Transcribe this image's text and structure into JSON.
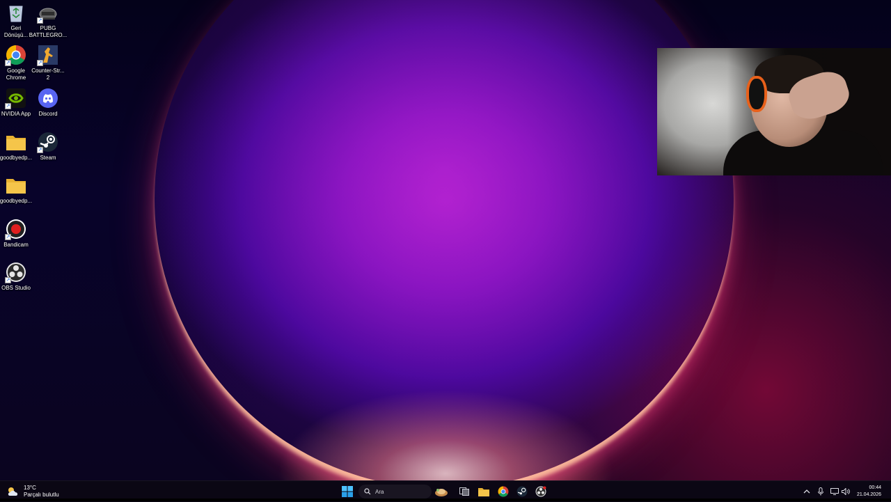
{
  "desktop": {
    "icons": [
      {
        "name": "recycle-bin",
        "label": "Geri\nDönüşü..."
      },
      {
        "name": "pubg",
        "label": "PUBG\nBATTLEGRO..."
      },
      {
        "name": "google-chrome",
        "label": "Google\nChrome"
      },
      {
        "name": "counter-strike-2",
        "label": "Counter-Str...\n2"
      },
      {
        "name": "nvidia-app",
        "label": "NVIDIA App"
      },
      {
        "name": "discord",
        "label": "Discord"
      },
      {
        "name": "folder-goodbyedp-1",
        "label": "goodbyedp..."
      },
      {
        "name": "steam",
        "label": "Steam"
      },
      {
        "name": "folder-goodbyedp-2",
        "label": "goodbyedp..."
      },
      {
        "name": "bandicam",
        "label": "Bandicam"
      },
      {
        "name": "obs-studio",
        "label": "OBS Studio"
      }
    ]
  },
  "taskbar": {
    "weather": {
      "temp": "13°C",
      "desc": "Parçalı bulutlu"
    },
    "search_placeholder": "Ara",
    "clock": {
      "time": "00:44",
      "date": "21.04.2026"
    }
  },
  "colors": {
    "accent": "#1e90ff",
    "folder": "#f5c54a",
    "discord": "#5865f2",
    "nvidia": "#76b900",
    "bandicam": "#e01f1f"
  }
}
